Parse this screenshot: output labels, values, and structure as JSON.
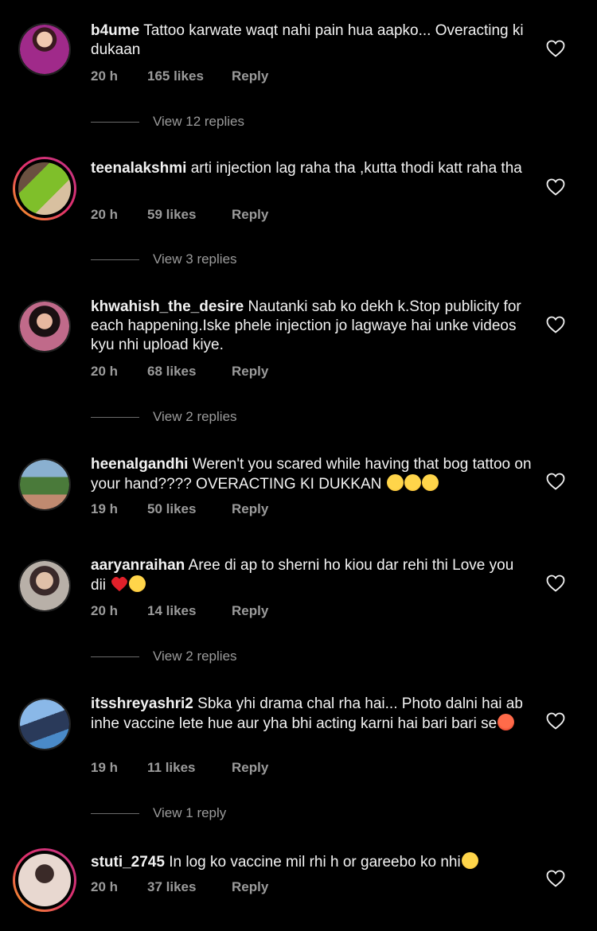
{
  "comments": [
    {
      "username": "b4ume",
      "text": "Tattoo karwate waqt nahi pain hua aapko... Overacting ki dukaan",
      "time": "20 h",
      "likes": "165 likes",
      "reply_label": "Reply",
      "view_replies": "View 12 replies",
      "avatar_colors": [
        "#7a2a6a",
        "#c23a9a"
      ]
    },
    {
      "username": "teenalakshmi",
      "text": "arti injection  lag raha tha ,kutta thodi katt raha tha",
      "time": "20 h",
      "likes": "59 likes",
      "reply_label": "Reply",
      "view_replies": "View 3 replies",
      "avatar_colors": [
        "#3b4a2a",
        "#8fbf3a"
      ]
    },
    {
      "username": "khwahish_the_desire",
      "text": "Nautanki sab ko dekh k.Stop publicity for each happening.Iske phele injection jo lagwaye hai unke videos kyu nhi upload kiye.",
      "time": "20 h",
      "likes": "68 likes",
      "reply_label": "Reply",
      "view_replies": "View 2 replies",
      "avatar_colors": [
        "#2a1a22",
        "#b8607a"
      ]
    },
    {
      "username": "heenalgandhi",
      "text": "Weren't you scared while having that bog tattoo on your hand???? OVERACTING KI DUKKAN",
      "time": "19 h",
      "likes": "50 likes",
      "reply_label": "Reply",
      "view_replies": "",
      "avatar_colors": [
        "#4a6a3a",
        "#a0c0d8"
      ]
    },
    {
      "username": "aaryanraihan",
      "text": "Aree di ap to sherni ho kiou dar rehi thi Love you dii",
      "time": "20 h",
      "likes": "14 likes",
      "reply_label": "Reply",
      "view_replies": "View 2 replies",
      "avatar_colors": [
        "#5a4a4a",
        "#d8d0c8"
      ]
    },
    {
      "username": "itsshreyashri2",
      "text": "Sbka yhi drama chal rha hai... Photo dalni hai ab inhe vaccine lete hue aur yha bhi acting karni hai bari bari se",
      "time": "19 h",
      "likes": "11 likes",
      "reply_label": "Reply",
      "view_replies": "View 1 reply",
      "avatar_colors": [
        "#1a3a6a",
        "#6aa0d8"
      ]
    },
    {
      "username": "stuti_2745",
      "text": "In log ko vaccine mil rhi h  or gareebo ko nhi",
      "time": "20 h",
      "likes": "37 likes",
      "reply_label": "Reply",
      "view_replies": "",
      "avatar_colors": [
        "#d8d8d8",
        "#5a4a48"
      ]
    }
  ],
  "icons": {
    "like": "heart-outline-icon"
  },
  "colors": {
    "background": "#000000",
    "text": "#f2f2f2",
    "meta": "#9b9b9b",
    "story_ring": [
      "#f9a31e",
      "#e1306c",
      "#c13584"
    ]
  }
}
